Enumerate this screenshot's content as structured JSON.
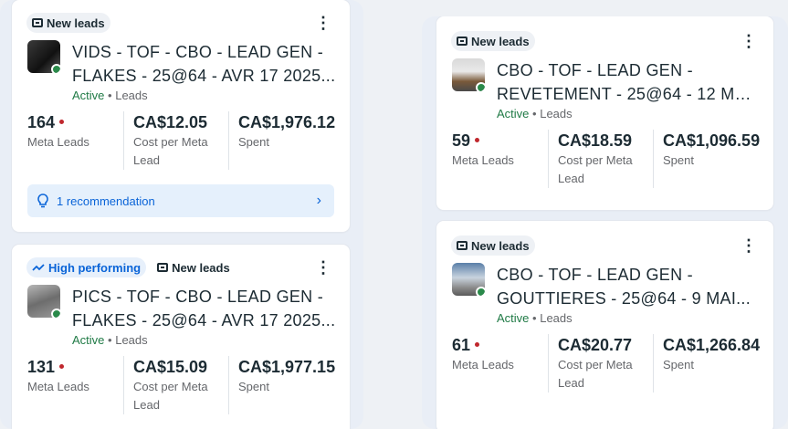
{
  "cards": [
    {
      "badges": [
        {
          "label": "New leads",
          "type": "new-leads"
        }
      ],
      "title_line1": "VIDS - TOF - CBO - LEAD GEN -",
      "title_line2": "FLAKES - 25@64 - AVR 17 2025...",
      "status": "Active",
      "objective": "Leads",
      "metrics": {
        "results_value": "164",
        "results_label": "Meta Leads",
        "cost_value": "CA$12.05",
        "cost_label": "Cost per Meta Lead",
        "spent_value": "CA$1,976.12",
        "spent_label": "Spent"
      },
      "recommendation": "1 recommendation"
    },
    {
      "badges": [
        {
          "label": "High performing",
          "type": "high-performing"
        },
        {
          "label": "New leads",
          "type": "new-leads"
        }
      ],
      "title_line1": "PICS - TOF - CBO - LEAD GEN -",
      "title_line2": "FLAKES - 25@64 - AVR 17 2025...",
      "status": "Active",
      "objective": "Leads",
      "metrics": {
        "results_value": "131",
        "results_label": "Meta Leads",
        "cost_value": "CA$15.09",
        "cost_label": "Cost per Meta Lead",
        "spent_value": "CA$1,977.15",
        "spent_label": "Spent"
      }
    },
    {
      "badges": [
        {
          "label": "New leads",
          "type": "new-leads"
        }
      ],
      "title_line1": "CBO - TOF - LEAD GEN -",
      "title_line2": "REVETEMENT - 25@64 - 12 MAI...",
      "status": "Active",
      "objective": "Leads",
      "metrics": {
        "results_value": "59",
        "results_label": "Meta Leads",
        "cost_value": "CA$18.59",
        "cost_label": "Cost per Meta Lead",
        "spent_value": "CA$1,096.59",
        "spent_label": "Spent"
      }
    },
    {
      "badges": [
        {
          "label": "New leads",
          "type": "new-leads"
        }
      ],
      "title_line1": "CBO - TOF - LEAD GEN -",
      "title_line2": "GOUTTIERES - 25@64 - 9 MAI...",
      "status": "Active",
      "objective": "Leads",
      "metrics": {
        "results_value": "61",
        "results_label": "Meta Leads",
        "cost_value": "CA$20.77",
        "cost_label": "Cost per Meta Lead",
        "spent_value": "CA$1,266.84",
        "spent_label": "Spent"
      }
    }
  ],
  "separator": "•",
  "menu_glyph": "⋮",
  "recommendation_chevron": "›",
  "colors": {
    "active_status": "#1f7a45",
    "high_performing": "#0a64d8",
    "red_indicator": "#c0272d",
    "recommendation_bg": "#e5f0fc"
  }
}
